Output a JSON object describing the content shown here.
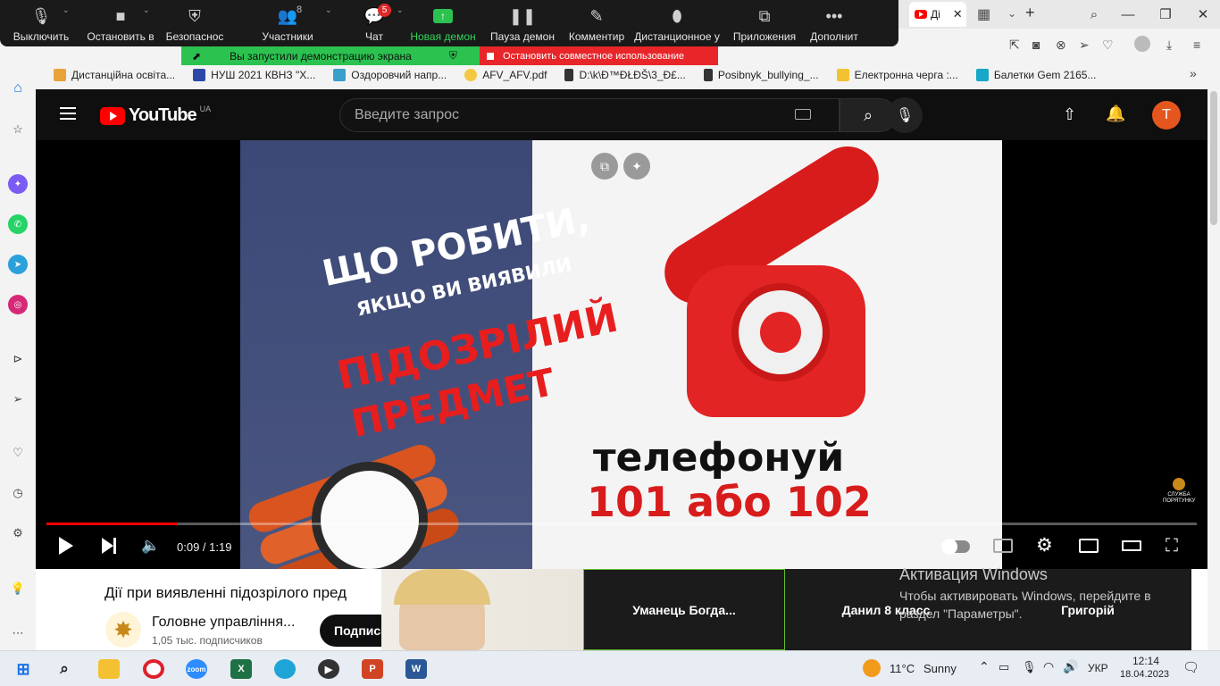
{
  "browser": {
    "tab_title": "Ді",
    "new_tab": "+"
  },
  "zoom_toolbar": {
    "items": [
      {
        "label": "Выключить"
      },
      {
        "label": "Остановить в"
      },
      {
        "label": "Безопаснос"
      },
      {
        "label": "Участники",
        "count": "8"
      },
      {
        "label": "Чат",
        "badge": "5"
      },
      {
        "label": "Новая демон"
      },
      {
        "label": "Пауза демон"
      },
      {
        "label": "Комментир"
      },
      {
        "label": "Дистанционное у"
      },
      {
        "label": "Приложения"
      },
      {
        "label": "Дополнит"
      }
    ],
    "sharing_notice": "Вы запустили демонстрацию экрана",
    "stop_sharing": "Остановить совместное использование"
  },
  "bookmarks": [
    {
      "label": "Дистанційна освіта...",
      "color": "#e8a33a"
    },
    {
      "label": "НУШ 2021 КВНЗ \"Х...",
      "color": "#2c4aa5"
    },
    {
      "label": "Оздоровчий напр...",
      "color": "#3aa0c9"
    },
    {
      "label": "AFV_AFV.pdf",
      "color": "#555555"
    },
    {
      "label": "D:\\k\\Ð™ÐŁÐŠ\\3_Ð£...",
      "color": "#222222"
    },
    {
      "label": "Posibnyk_bullying_...",
      "color": "#555555"
    },
    {
      "label": "Електронна черга :...",
      "color": "#f2c230"
    },
    {
      "label": "Балетки Gem 2165...",
      "color": "#17a7c9"
    }
  ],
  "youtube": {
    "logo_text": "YouTube",
    "region": "UA",
    "search_placeholder": "Введите запрос",
    "avatar_letter": "T",
    "video": {
      "frame_text": {
        "line1": "ЩО РОБИТИ,",
        "line2": "ЯКЩО ВИ ВИЯВИЛИ",
        "line3": "ПІДОЗРІЛИЙ",
        "line4": "ПРЕДМЕТ",
        "call": "телефонуй",
        "numbers": "101 або 102"
      },
      "watermark": "СЛУЖБА ПОРЯТУНКУ",
      "time": "0:09 / 1:19",
      "progress_fraction": 0.1139
    },
    "title": "Дії при виявленні підозрілого пред",
    "channel_name": "Головне управління...",
    "subscribers": "1,05 тыс. подписчиков",
    "subscribe_label": "Подписаться"
  },
  "zoom_gallery": {
    "participants": [
      "Уманець Богда...",
      "Данил 8 класс",
      "Григорій"
    ]
  },
  "windows_activation": {
    "title": "Активация Windows",
    "line1": "Чтобы активировать Windows, перейдите в",
    "line2": "раздел \"Параметры\"."
  },
  "taskbar": {
    "weather_temp": "11°C",
    "weather_desc": "Sunny",
    "language": "УКР",
    "time": "12:14",
    "date": "18.04.2023"
  },
  "colors": {
    "zoom_green": "#2bc24f",
    "zoom_red": "#e8262a",
    "youtube_red": "#ff0000",
    "avatar": "#e5561e"
  }
}
